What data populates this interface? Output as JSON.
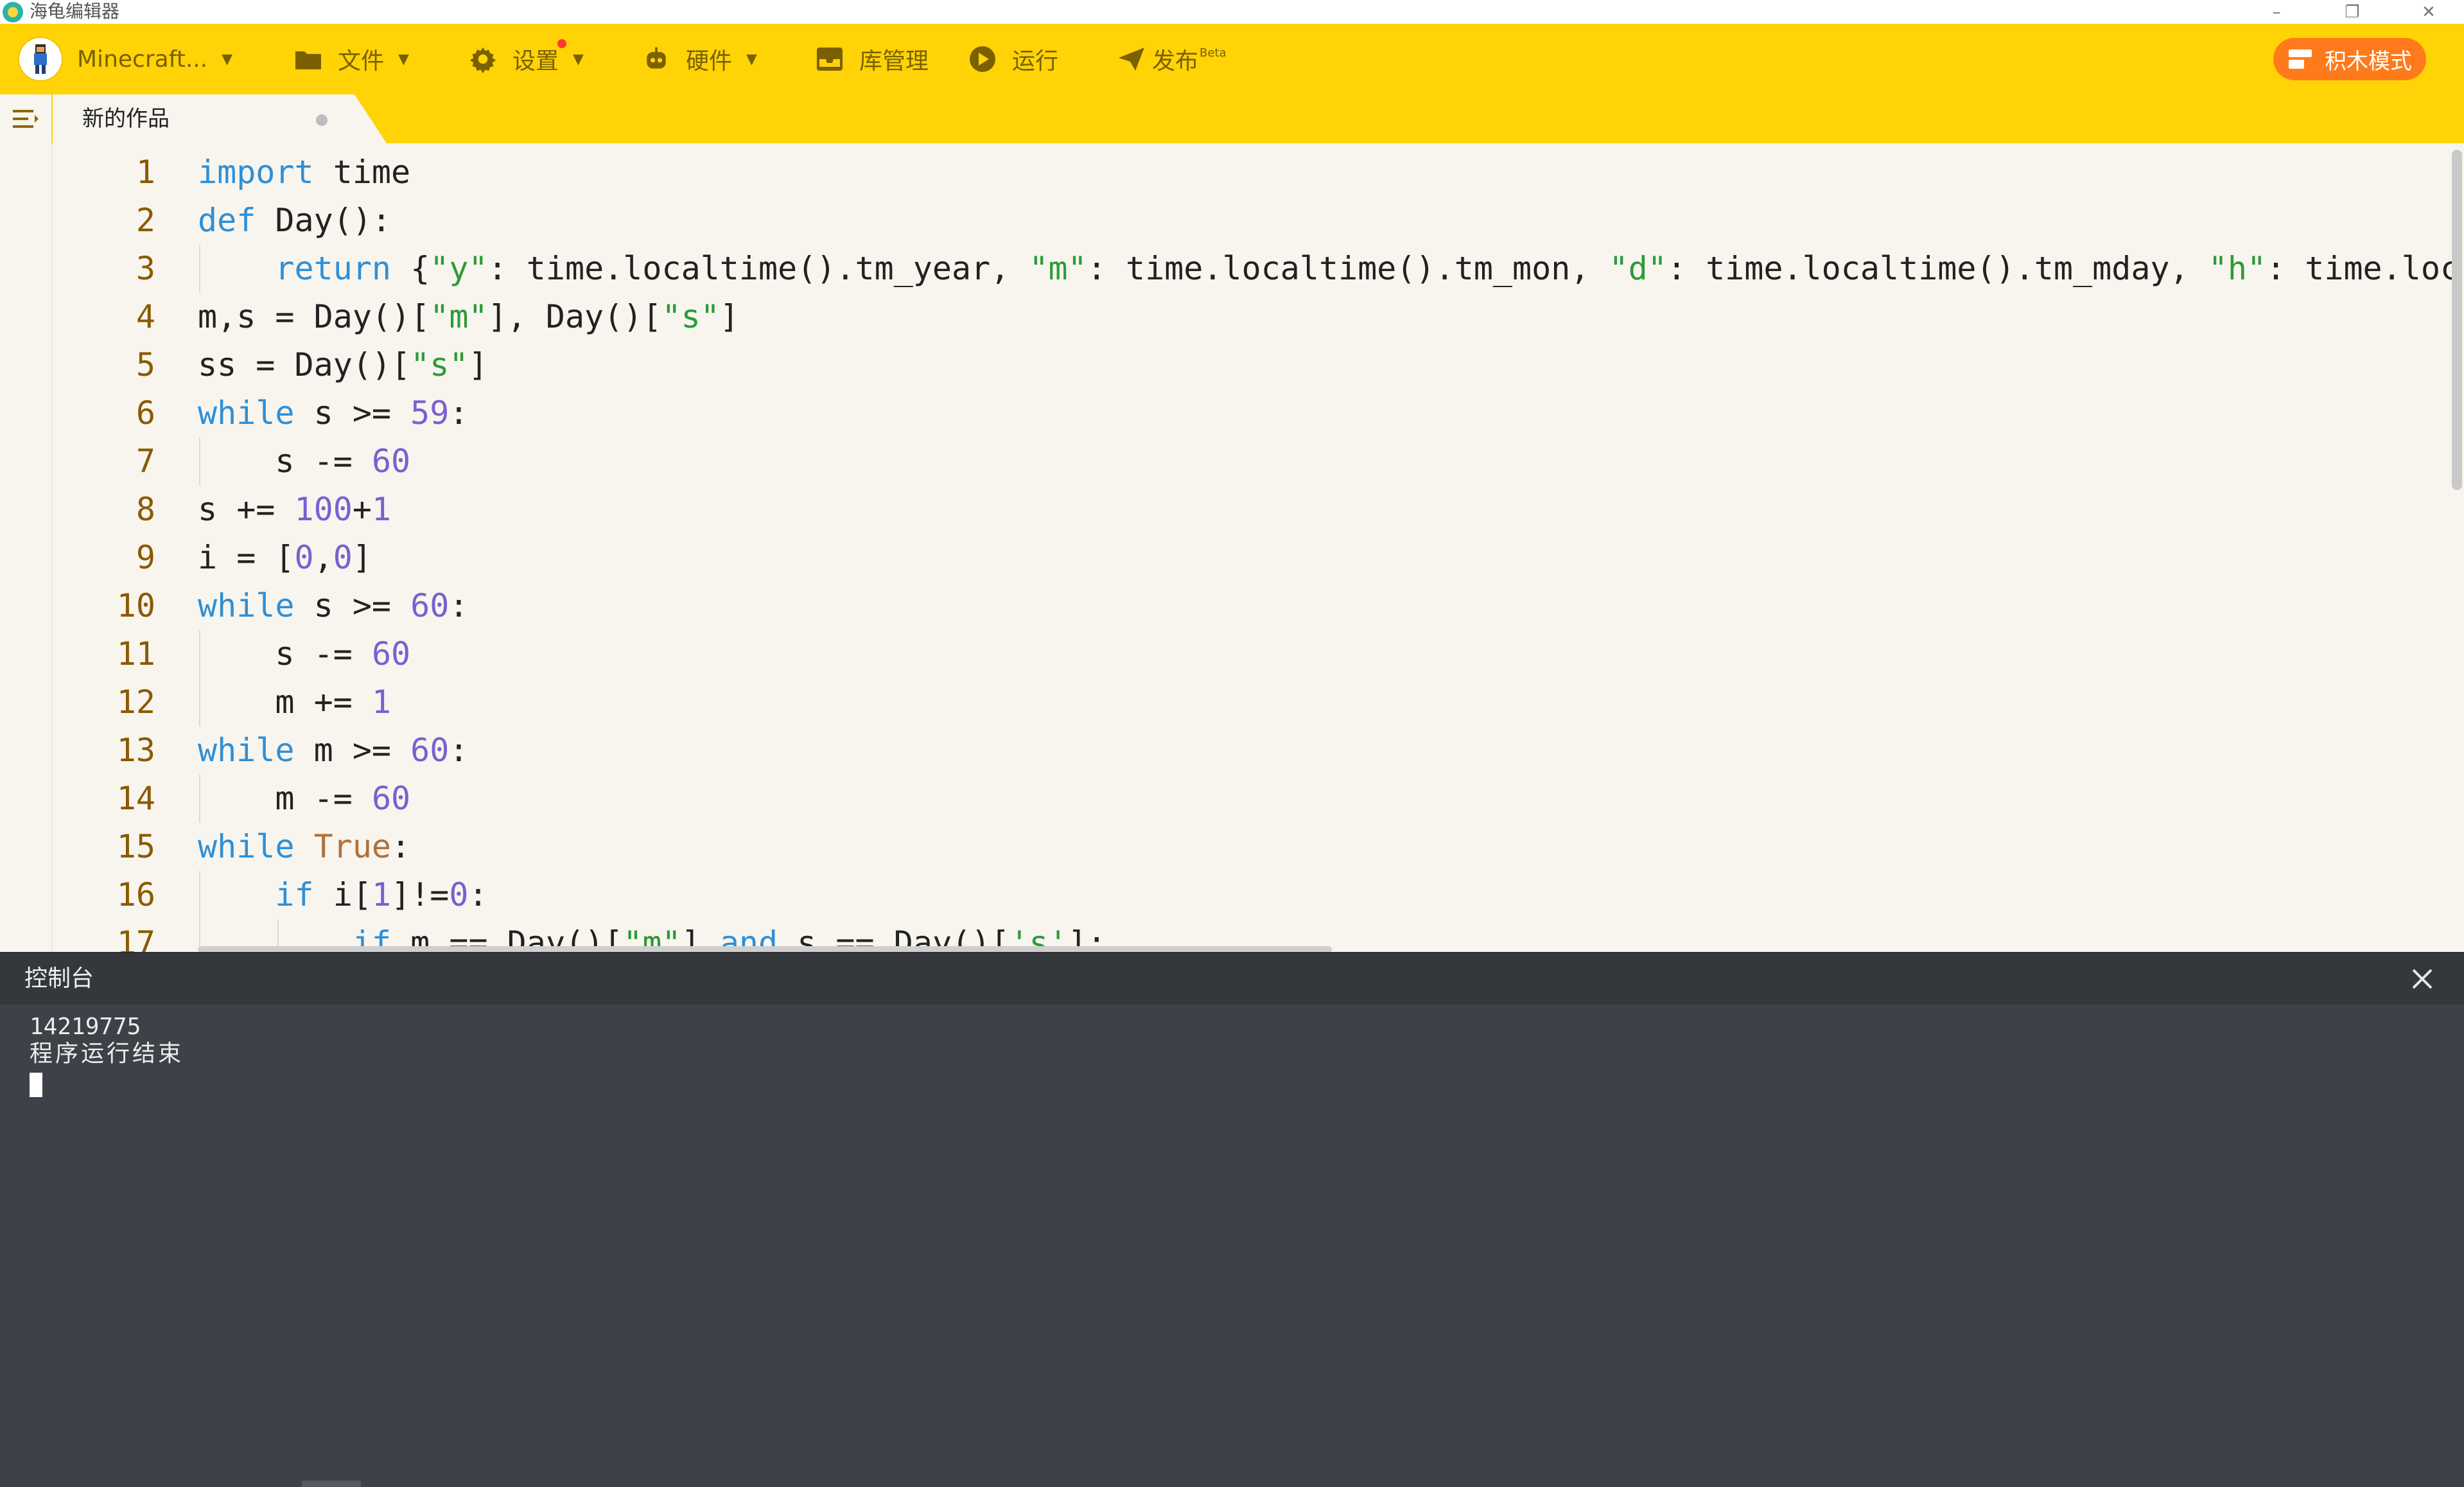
{
  "window": {
    "title": "海龟编辑器",
    "controls": [
      "–",
      "❐",
      "✕"
    ]
  },
  "toolbar": {
    "env_label": "Minecraft...",
    "file_label": "文件",
    "settings_label": "设置",
    "hardware_label": "硬件",
    "library_label": "库管理",
    "run_label": "运行",
    "publish_label": "发布",
    "publish_badge": "Beta",
    "block_mode_label": "积木模式"
  },
  "tabs": {
    "active_name": "新的作品"
  },
  "editor": {
    "line_numbers": [
      "1",
      "2",
      "3",
      "4",
      "5",
      "6",
      "7",
      "8",
      "9",
      "10",
      "11",
      "12",
      "13",
      "14",
      "15",
      "16",
      "17"
    ],
    "lines": [
      [
        {
          "t": "import",
          "c": "kw"
        },
        {
          "t": " time"
        }
      ],
      [
        {
          "t": "def",
          "c": "kw"
        },
        {
          "t": " Day():"
        }
      ],
      [
        {
          "t": "    "
        },
        {
          "t": "return",
          "c": "kw"
        },
        {
          "t": " {"
        },
        {
          "t": "\"y\"",
          "c": "str"
        },
        {
          "t": ": time.localtime().tm_year, "
        },
        {
          "t": "\"m\"",
          "c": "str"
        },
        {
          "t": ": time.localtime().tm_mon, "
        },
        {
          "t": "\"d\"",
          "c": "str"
        },
        {
          "t": ": time.localtime().tm_mday, "
        },
        {
          "t": "\"h\"",
          "c": "str"
        },
        {
          "t": ": time.loc"
        }
      ],
      [
        {
          "t": "m,s = Day()["
        },
        {
          "t": "\"m\"",
          "c": "str"
        },
        {
          "t": "], Day()["
        },
        {
          "t": "\"s\"",
          "c": "str"
        },
        {
          "t": "]"
        }
      ],
      [
        {
          "t": "ss = Day()["
        },
        {
          "t": "\"s\"",
          "c": "str"
        },
        {
          "t": "]"
        }
      ],
      [
        {
          "t": "while",
          "c": "kw"
        },
        {
          "t": " s >= "
        },
        {
          "t": "59",
          "c": "num"
        },
        {
          "t": ":"
        }
      ],
      [
        {
          "t": "    s -= "
        },
        {
          "t": "60",
          "c": "num"
        }
      ],
      [
        {
          "t": "s += "
        },
        {
          "t": "100",
          "c": "num"
        },
        {
          "t": "+"
        },
        {
          "t": "1",
          "c": "num"
        }
      ],
      [
        {
          "t": "i = ["
        },
        {
          "t": "0",
          "c": "num"
        },
        {
          "t": ","
        },
        {
          "t": "0",
          "c": "num"
        },
        {
          "t": "]"
        }
      ],
      [
        {
          "t": "while",
          "c": "kw"
        },
        {
          "t": " s >= "
        },
        {
          "t": "60",
          "c": "num"
        },
        {
          "t": ":"
        }
      ],
      [
        {
          "t": "    s -= "
        },
        {
          "t": "60",
          "c": "num"
        }
      ],
      [
        {
          "t": "    m += "
        },
        {
          "t": "1",
          "c": "num"
        }
      ],
      [
        {
          "t": "while",
          "c": "kw"
        },
        {
          "t": " m >= "
        },
        {
          "t": "60",
          "c": "num"
        },
        {
          "t": ":"
        }
      ],
      [
        {
          "t": "    m -= "
        },
        {
          "t": "60",
          "c": "num"
        }
      ],
      [
        {
          "t": "while",
          "c": "kw"
        },
        {
          "t": " "
        },
        {
          "t": "True",
          "c": "const"
        },
        {
          "t": ":"
        }
      ],
      [
        {
          "t": "    "
        },
        {
          "t": "if",
          "c": "kw"
        },
        {
          "t": " i["
        },
        {
          "t": "1",
          "c": "num"
        },
        {
          "t": "]!="
        },
        {
          "t": "0",
          "c": "num"
        },
        {
          "t": ":"
        }
      ],
      [
        {
          "t": "        "
        },
        {
          "t": "if",
          "c": "kw"
        },
        {
          "t": " m == Day()["
        },
        {
          "t": "\"m\"",
          "c": "str"
        },
        {
          "t": "] "
        },
        {
          "t": "and",
          "c": "kw"
        },
        {
          "t": " s == Day()["
        },
        {
          "t": "'s'",
          "c": "str"
        },
        {
          "t": "]:"
        }
      ]
    ]
  },
  "run_float_label": "运行",
  "console": {
    "title": "控制台",
    "output": [
      "14219775",
      "程序运行结束"
    ]
  },
  "colors": {
    "toolbar_bg": "#ffd306",
    "accent_orange": "#ff7a1a",
    "keyword": "#2f8fd6",
    "string": "#2c9a3a",
    "number": "#7b5fd0",
    "console_bg": "#3e4147"
  }
}
